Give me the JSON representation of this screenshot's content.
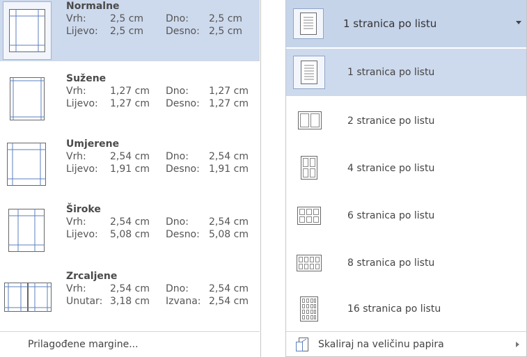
{
  "margins": {
    "items": [
      {
        "id": "normalne",
        "title": "Normalne",
        "r1": [
          "Vrh:",
          "2,5 cm",
          "Dno:",
          "2,5 cm"
        ],
        "r2": [
          "Lijevo:",
          "2,5 cm",
          "Desno:",
          "2,5 cm"
        ],
        "selected": true
      },
      {
        "id": "suzene",
        "title": "Sužene",
        "r1": [
          "Vrh:",
          "1,27 cm",
          "Dno:",
          "1,27 cm"
        ],
        "r2": [
          "Lijevo:",
          "1,27 cm",
          "Desno:",
          "1,27 cm"
        ],
        "selected": false
      },
      {
        "id": "umjerene",
        "title": "Umjerene",
        "r1": [
          "Vrh:",
          "2,54 cm",
          "Dno:",
          "2,54 cm"
        ],
        "r2": [
          "Lijevo:",
          "1,91 cm",
          "Desno:",
          "1,91 cm"
        ],
        "selected": false
      },
      {
        "id": "siroke",
        "title": "Široke",
        "r1": [
          "Vrh:",
          "2,54 cm",
          "Dno:",
          "2,54 cm"
        ],
        "r2": [
          "Lijevo:",
          "5,08 cm",
          "Desno:",
          "5,08 cm"
        ],
        "selected": false
      },
      {
        "id": "zrcaljene",
        "title": "Zrcaljene",
        "r1": [
          "Vrh:",
          "2,54 cm",
          "Dno:",
          "2,54 cm"
        ],
        "r2": [
          "Unutar:",
          "3,18 cm",
          "Izvana:",
          "2,54 cm"
        ],
        "selected": false
      }
    ],
    "custom_label": "Prilagođene margine..."
  },
  "pages": {
    "header_label": "1 stranica po listu",
    "items": [
      {
        "label": "1 stranica po listu",
        "selected": true
      },
      {
        "label": "2 stranice po listu",
        "selected": false
      },
      {
        "label": "4 stranice po listu",
        "selected": false
      },
      {
        "label": "6 stranica po listu",
        "selected": false
      },
      {
        "label": "8 stranica po listu",
        "selected": false
      },
      {
        "label": "16 stranica po listu",
        "selected": false
      }
    ],
    "scale_label": "Skaliraj na veličinu papira"
  },
  "colors": {
    "selected_bg": "#cdd9ec",
    "header_bg": "#c6d4ea",
    "icon_stroke": "#666666",
    "margin_line": "#5b7fbf"
  }
}
